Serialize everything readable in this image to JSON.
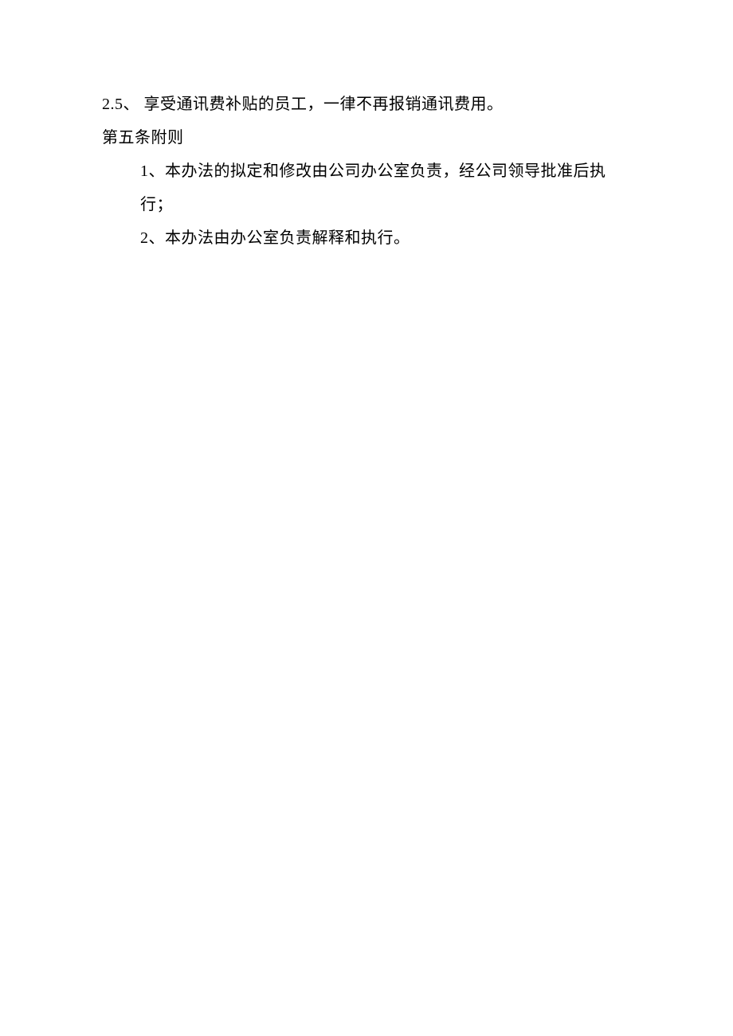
{
  "lines": [
    {
      "text": "2.5、 享受通讯费补贴的员工，一律不再报销通讯费用。",
      "indent": false
    },
    {
      "text": "第五条附则",
      "indent": false
    },
    {
      "text": "1、本办法的拟定和修改由公司办公室负责，经公司领导批准后执行；",
      "indent": true
    },
    {
      "text": "2、本办法由办公室负责解释和执行。",
      "indent": true
    }
  ]
}
